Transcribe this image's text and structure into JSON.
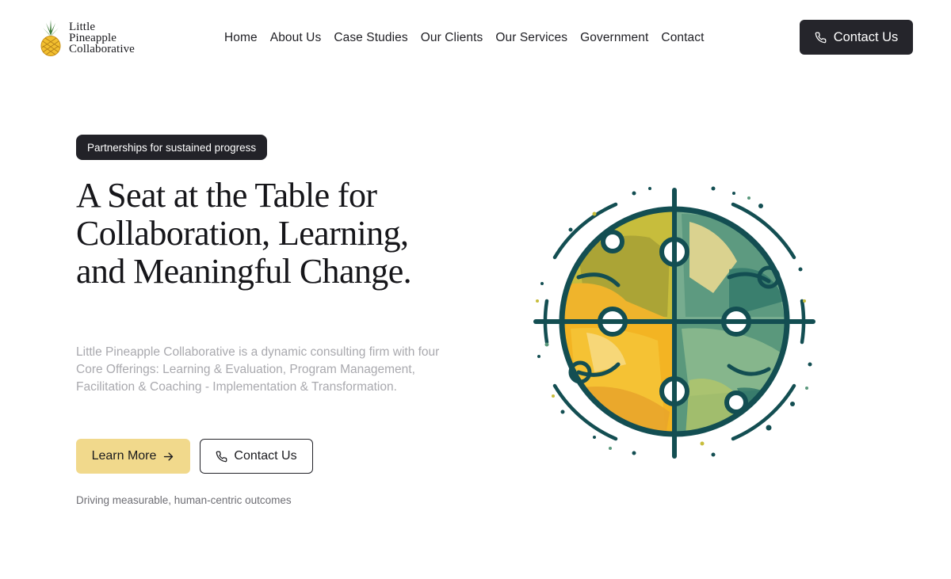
{
  "brand": {
    "line1": "Little",
    "line2": "Pineapple",
    "line3": "Collaborative"
  },
  "nav": {
    "items": [
      {
        "label": "Home"
      },
      {
        "label": "About Us"
      },
      {
        "label": "Case Studies"
      },
      {
        "label": "Our Clients"
      },
      {
        "label": "Our Services"
      },
      {
        "label": "Government"
      },
      {
        "label": "Contact"
      }
    ],
    "cta_label": "Contact Us"
  },
  "hero": {
    "badge": "Partnerships for sustained progress",
    "title": "A Seat at the Table for Collaboration, Learning, and Meaningful Change.",
    "description": "Little Pineapple Collaborative is a dynamic consulting firm with four Core Offerings: Learning & Evaluation, Program Management, Facilitation & Coaching - Implementation & Transformation.",
    "primary_button": "Learn More",
    "secondary_button": "Contact Us",
    "tagline": "Driving measurable, human-centric outcomes"
  },
  "colors": {
    "dark": "#222228",
    "accent_yellow": "#f1d98c",
    "art_teal": "#134e52",
    "art_green": "#5f9e85",
    "art_olive": "#a5a33a",
    "art_gold": "#f0b52c"
  },
  "icons": {
    "phone": "phone-icon",
    "arrow": "arrow-right-icon",
    "logo": "pineapple-icon"
  }
}
